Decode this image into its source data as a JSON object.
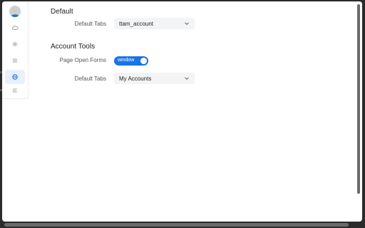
{
  "sidebar": {
    "items": [
      {
        "icon": "cloud-icon"
      },
      {
        "icon": "sparkle-icon"
      },
      {
        "icon": "list-icon"
      },
      {
        "icon": "globe-icon",
        "active": true
      },
      {
        "icon": "settings-list-icon"
      }
    ]
  },
  "sections": {
    "default": {
      "title": "Default",
      "tabs_label": "Default Tabs",
      "tabs_value": "ttam_account"
    },
    "account_tools": {
      "title": "Account Tools",
      "open_forms_label": "Page Open Forms",
      "open_forms_value": "window",
      "tabs_label": "Default Tabs",
      "tabs_value": "My Accounts"
    }
  },
  "colors": {
    "accent": "#1a73e8",
    "active_bg": "#e8f0fe"
  }
}
